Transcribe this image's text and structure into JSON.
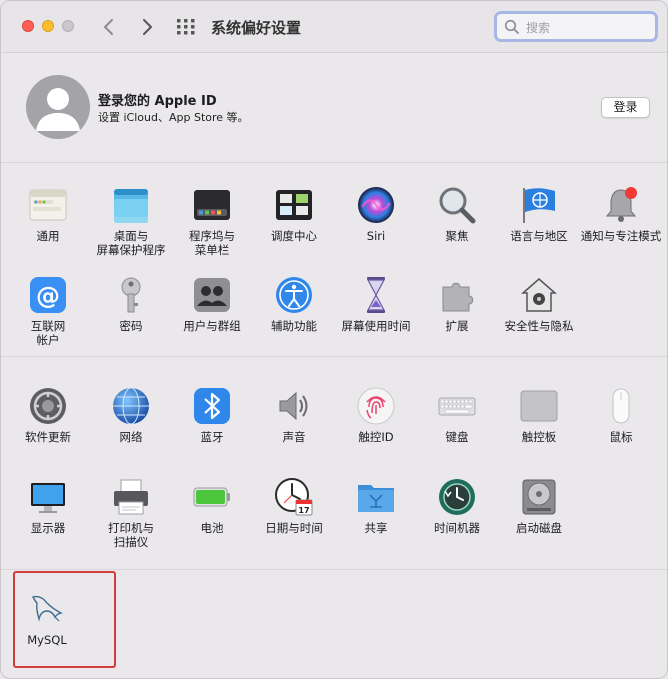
{
  "window": {
    "title": "系统偏好设置"
  },
  "search": {
    "placeholder": "搜索"
  },
  "account": {
    "title": "登录您的 Apple ID",
    "subtitle": "设置 iCloud、App Store 等。",
    "login_label": "登录"
  },
  "panes_row1": [
    {
      "label": "通用",
      "icon": "general-icon"
    },
    {
      "label": "桌面与\n屏幕保护程序",
      "icon": "desktop-screensaver-icon"
    },
    {
      "label": "程序坞与\n菜单栏",
      "icon": "dock-menubar-icon"
    },
    {
      "label": "调度中心",
      "icon": "mission-control-icon"
    },
    {
      "label": "Siri",
      "icon": "siri-icon"
    },
    {
      "label": "聚焦",
      "icon": "spotlight-icon"
    },
    {
      "label": "语言与地区",
      "icon": "language-region-icon"
    },
    {
      "label": "通知与专注模式",
      "icon": "notifications-icon"
    }
  ],
  "panes_row2": [
    {
      "label": "互联网\n帐户",
      "icon": "internet-accounts-icon"
    },
    {
      "label": "密码",
      "icon": "passwords-icon"
    },
    {
      "label": "用户与群组",
      "icon": "users-groups-icon"
    },
    {
      "label": "辅助功能",
      "icon": "accessibility-icon"
    },
    {
      "label": "屏幕使用时间",
      "icon": "screen-time-icon"
    },
    {
      "label": "扩展",
      "icon": "extensions-icon"
    },
    {
      "label": "安全性与隐私",
      "icon": "security-privacy-icon"
    }
  ],
  "panes_row3": [
    {
      "label": "软件更新",
      "icon": "software-update-icon"
    },
    {
      "label": "网络",
      "icon": "network-icon"
    },
    {
      "label": "蓝牙",
      "icon": "bluetooth-icon"
    },
    {
      "label": "声音",
      "icon": "sound-icon"
    },
    {
      "label": "触控ID",
      "icon": "touch-id-icon"
    },
    {
      "label": "键盘",
      "icon": "keyboard-icon"
    },
    {
      "label": "触控板",
      "icon": "trackpad-icon"
    },
    {
      "label": "鼠标",
      "icon": "mouse-icon"
    }
  ],
  "panes_row4": [
    {
      "label": "显示器",
      "icon": "displays-icon"
    },
    {
      "label": "打印机与\n扫描仪",
      "icon": "printers-scanners-icon"
    },
    {
      "label": "电池",
      "icon": "battery-icon"
    },
    {
      "label": "日期与时间",
      "icon": "date-time-icon",
      "day": "17"
    },
    {
      "label": "共享",
      "icon": "sharing-icon"
    },
    {
      "label": "时间机器",
      "icon": "time-machine-icon"
    },
    {
      "label": "启动磁盘",
      "icon": "startup-disk-icon"
    }
  ],
  "panes_other": [
    {
      "label": "MySQL",
      "icon": "mysql-dolphin-icon"
    }
  ],
  "colors": {
    "highlight": "#d23c3c",
    "accent": "#3a82f7",
    "search_ring": "#a8b8e6"
  }
}
